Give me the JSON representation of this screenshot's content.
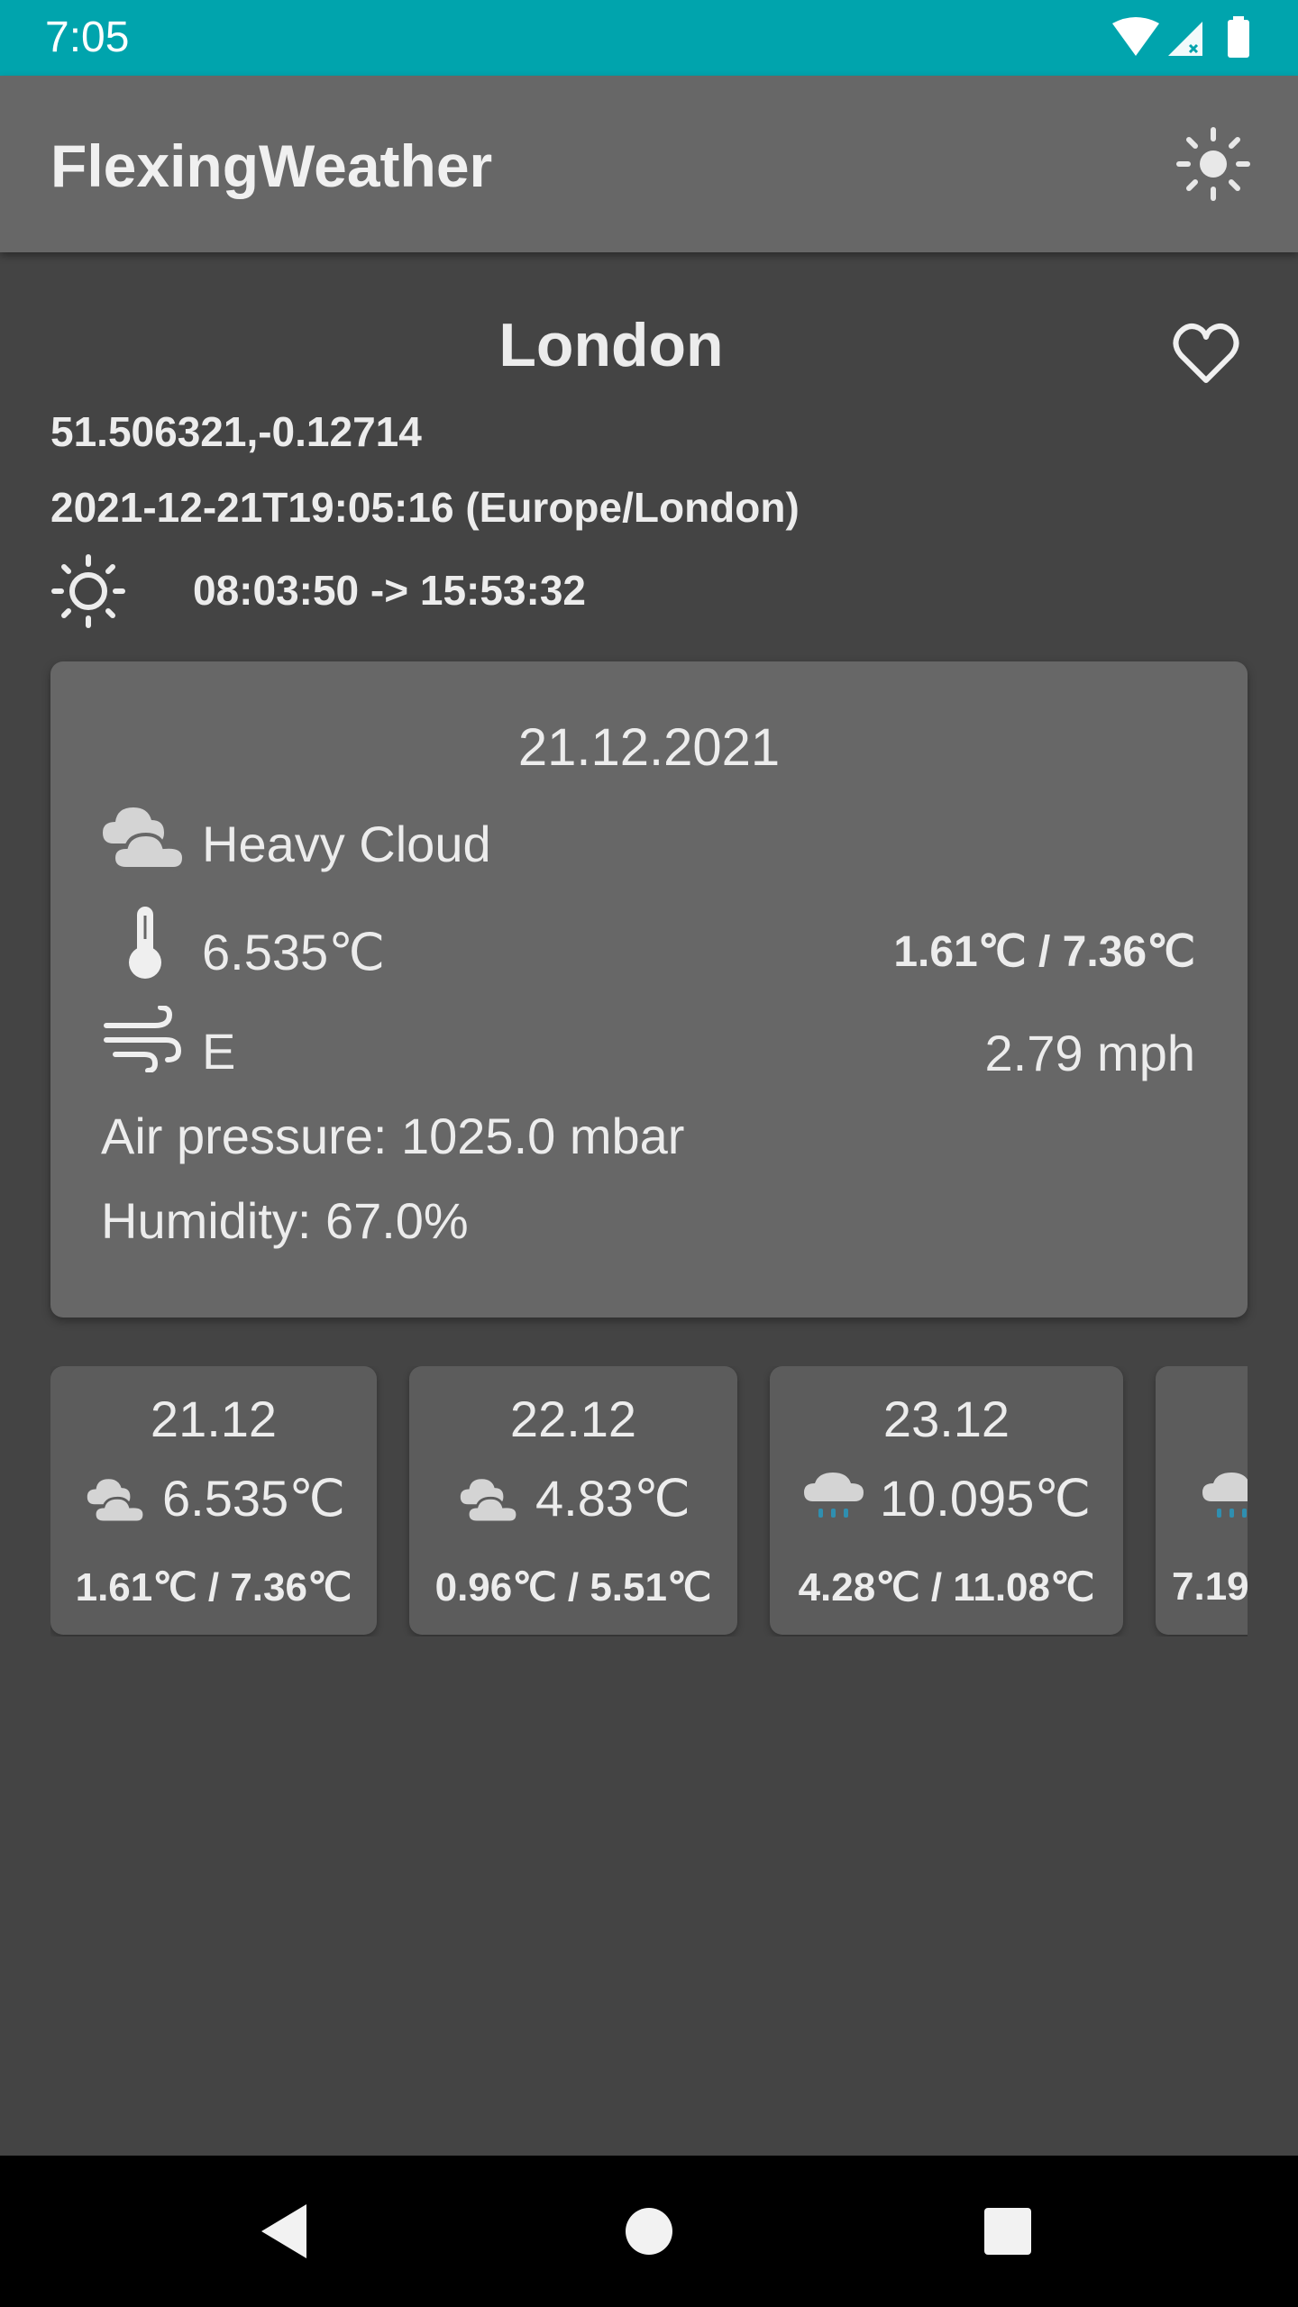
{
  "status_bar": {
    "time": "7:05"
  },
  "app_bar": {
    "title": "FlexingWeather"
  },
  "location": {
    "city": "London",
    "coords": "51.506321,-0.12714",
    "datetime": "2021-12-21T19:05:16 (Europe/London)",
    "sun_times": "08:03:50 -> 15:53:32"
  },
  "today": {
    "date": "21.12.2021",
    "condition": "Heavy Cloud",
    "temp": "6.535℃",
    "minmax": "1.61℃ / 7.36℃",
    "wind_dir": "E",
    "wind_speed": "2.79 mph",
    "pressure": "Air pressure: 1025.0 mbar",
    "humidity": "Humidity: 67.0%"
  },
  "forecast": [
    {
      "date": "21.12",
      "icon": "heavy-cloud-icon",
      "temp": "6.535℃",
      "minmax": "1.61℃ / 7.36℃"
    },
    {
      "date": "22.12",
      "icon": "heavy-cloud-icon",
      "temp": "4.83℃",
      "minmax": "0.96℃ / 5.51℃"
    },
    {
      "date": "23.12",
      "icon": "rain-icon",
      "temp": "10.095℃",
      "minmax": "4.28℃ / 11.08℃"
    },
    {
      "date": "",
      "icon": "rain-icon",
      "temp": "",
      "minmax": "7.19"
    }
  ],
  "colors": {
    "status_bar": "#00a4ad",
    "app_bar": "#676767",
    "background": "#444444",
    "card": "#676767",
    "rain_drops": "#2f8fb0"
  }
}
